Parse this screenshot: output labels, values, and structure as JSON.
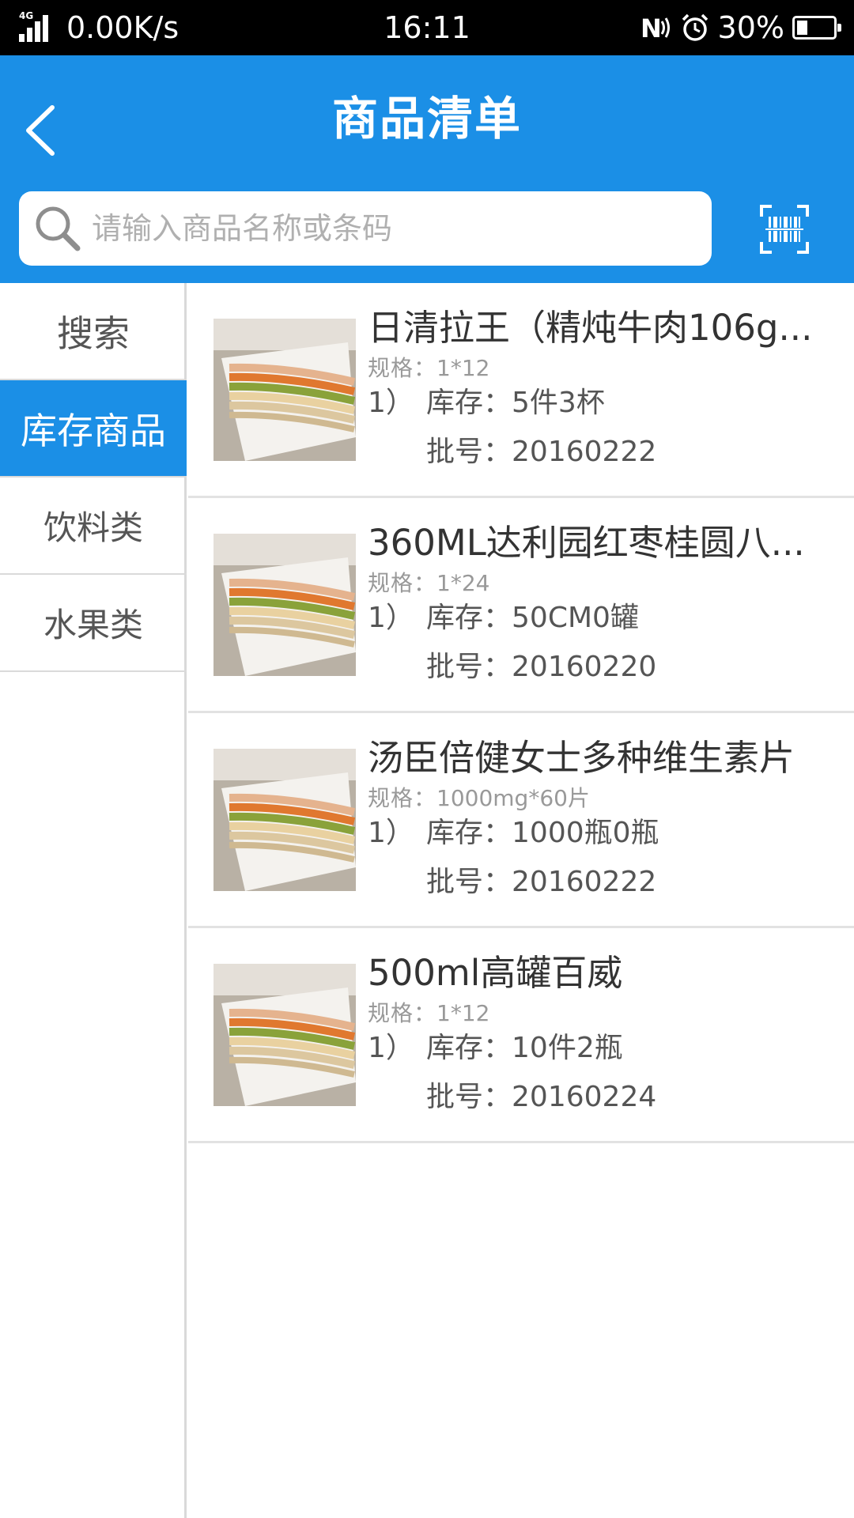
{
  "status_bar": {
    "network_type": "4G",
    "speed": "0.00K/s",
    "time": "16:11",
    "battery_percent": "30%",
    "battery_level": 0.3
  },
  "header": {
    "title": "商品清单",
    "back_icon": "chevron-left-icon",
    "search_placeholder": "请输入商品名称或条码",
    "scan_icon": "barcode-scan-icon",
    "background_color": "#1b8fe6"
  },
  "sidebar": {
    "items": [
      {
        "label": "搜索",
        "active": false
      },
      {
        "label": "库存商品",
        "active": true
      },
      {
        "label": "饮料类",
        "active": false
      },
      {
        "label": "水果类",
        "active": false
      }
    ]
  },
  "products": [
    {
      "name": "日清拉王（精炖牛肉106g...",
      "spec_label": "规格：",
      "spec_value": "1*12",
      "index": "1）",
      "stock_label": "库存：",
      "stock_value": "5件3杯",
      "batch_label": "批号：",
      "batch_value": "20160222"
    },
    {
      "name": "360ML达利园红枣桂圆八...",
      "spec_label": "规格：",
      "spec_value": "1*24",
      "index": "1）",
      "stock_label": "库存：",
      "stock_value": "50CM0罐",
      "batch_label": "批号：",
      "batch_value": "20160220"
    },
    {
      "name": "汤臣倍健女士多种维生素片",
      "spec_label": "规格：",
      "spec_value": "1000mg*60片",
      "index": "1）",
      "stock_label": "库存：",
      "stock_value": "1000瓶0瓶",
      "batch_label": "批号：",
      "batch_value": "20160222"
    },
    {
      "name": "500ml高罐百威",
      "spec_label": "规格：",
      "spec_value": "1*12",
      "index": "1）",
      "stock_label": "库存：",
      "stock_value": "10件2瓶",
      "batch_label": "批号：",
      "batch_value": "20160224"
    }
  ]
}
